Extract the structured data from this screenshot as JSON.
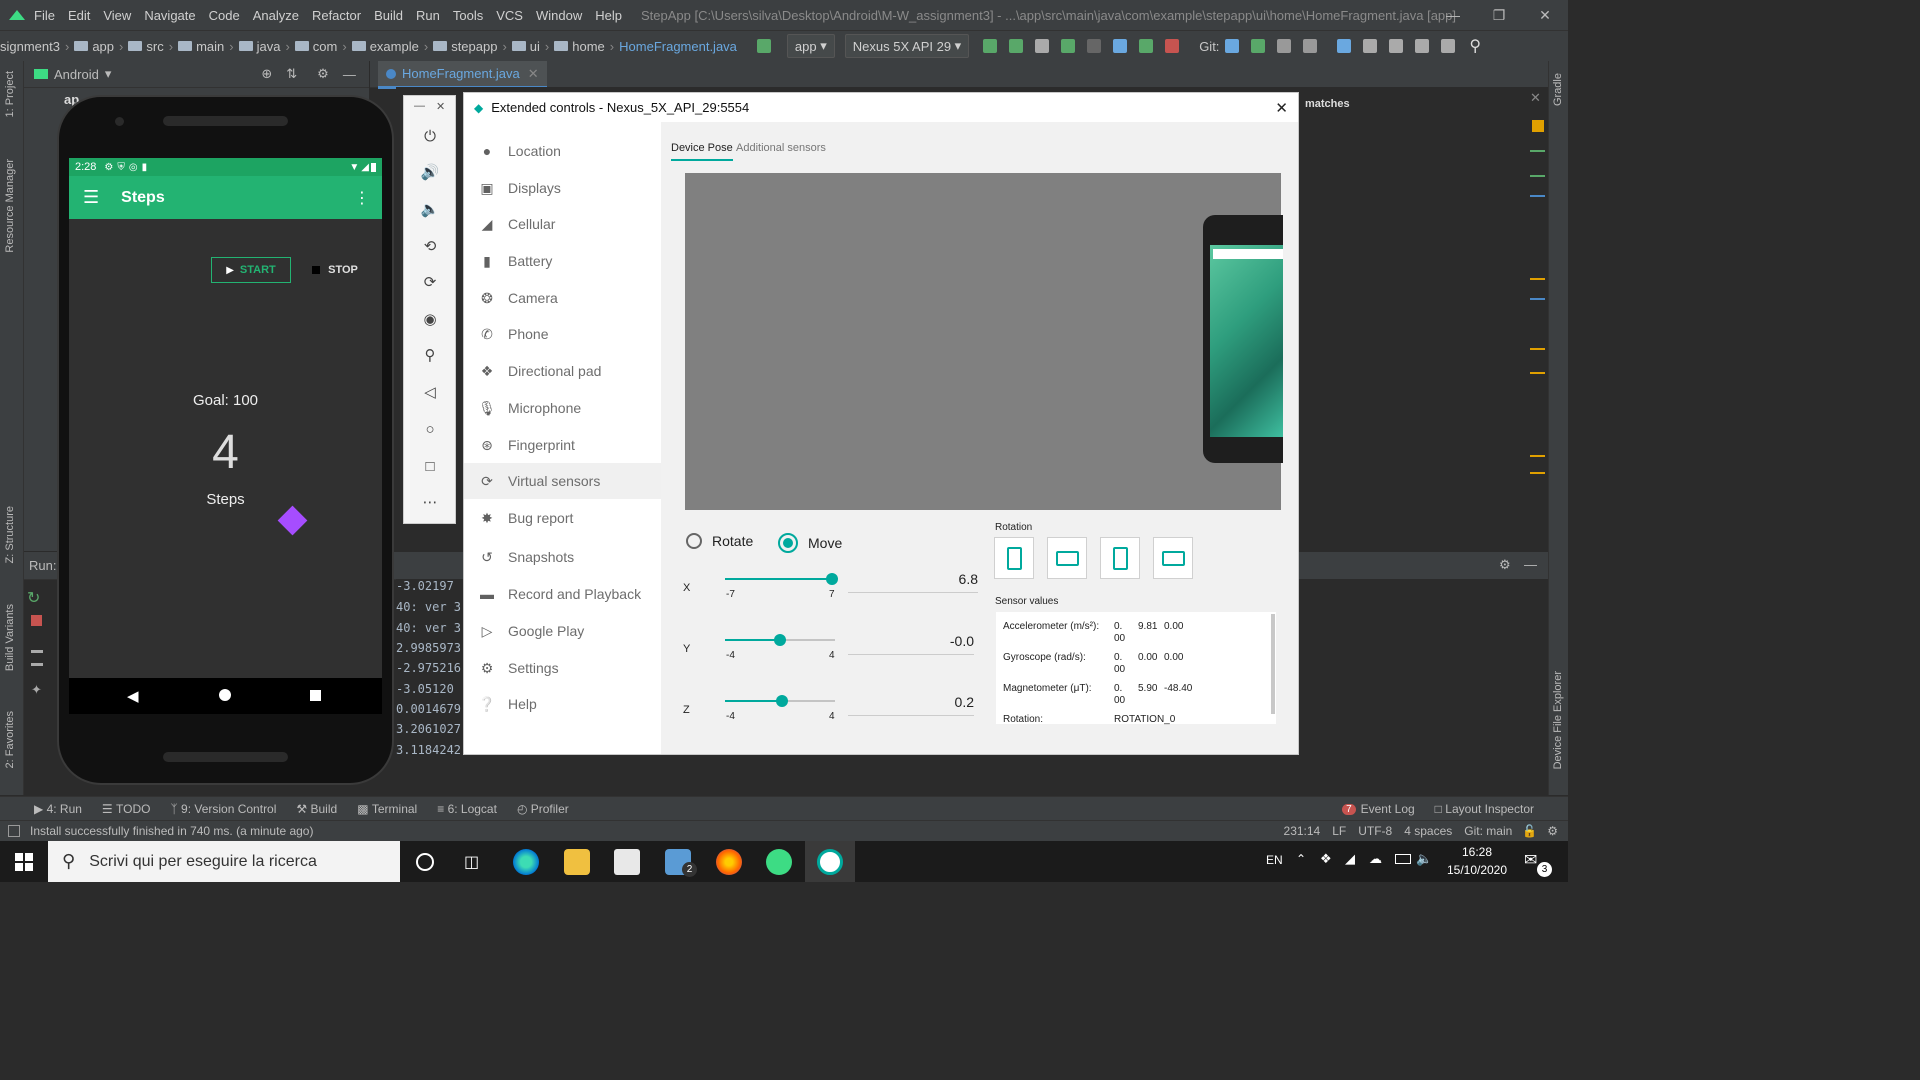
{
  "ide": {
    "menu": [
      "File",
      "Edit",
      "View",
      "Navigate",
      "Code",
      "Analyze",
      "Refactor",
      "Build",
      "Run",
      "Tools",
      "VCS",
      "Window",
      "Help"
    ],
    "window_title": "StepApp [C:\\Users\\silva\\Desktop\\Android\\M-W_assignment3] - ...\\app\\src\\main\\java\\com\\example\\stepapp\\ui\\home\\HomeFragment.java [app]",
    "breadcrumb": [
      "signment3",
      "app",
      "src",
      "main",
      "java",
      "com",
      "example",
      "stepapp",
      "ui",
      "home",
      "HomeFragment.java"
    ],
    "run_config": "app",
    "device_selector": "Nexus 5X API 29",
    "git_label": "Git:",
    "project_view": "Android",
    "editor_tab": "HomeFragment.java",
    "project_tree_stub": "ap",
    "find_matches": "matches",
    "run_label": "Run:",
    "log_lines": [
      "-3.02197",
      "40: ver 3",
      "40: ver 3",
      "2.9985973",
      "-2.975216",
      "-3.05120",
      "0.0014679",
      "3.2061027",
      "3.1184242"
    ],
    "left_strip": [
      "1: Project",
      "Resource Manager",
      "Z: Structure",
      "Build Variants",
      "2: Favorites"
    ],
    "right_strip": [
      "Gradle",
      "Device File Explorer"
    ],
    "tool_tabs": [
      "4: Run",
      "TODO",
      "9: Version Control",
      "Build",
      "Terminal",
      "6: Logcat",
      "Profiler"
    ],
    "event_log_count": "7",
    "event_log": "Event Log",
    "layout_inspector": "Layout Inspector",
    "status_message": "Install successfully finished in 740 ms. (a minute ago)",
    "status_right": [
      "231:14",
      "LF",
      "UTF-8",
      "4 spaces",
      "Git: main"
    ]
  },
  "phone": {
    "time": "2:28",
    "app_title": "Steps",
    "start_label": "START",
    "stop_label": "STOP",
    "goal": "Goal: 100",
    "steps_count": "4",
    "steps_label": "Steps"
  },
  "extended_controls": {
    "title": "Extended controls - Nexus_5X_API_29:5554",
    "sidebar": [
      "Location",
      "Displays",
      "Cellular",
      "Battery",
      "Camera",
      "Phone",
      "Directional pad",
      "Microphone",
      "Fingerprint",
      "Virtual sensors",
      "Bug report",
      "Snapshots",
      "Record and Playback",
      "Google Play",
      "Settings",
      "Help"
    ],
    "selected": "Virtual sensors",
    "tabs": [
      "Device Pose",
      "Additional sensors"
    ],
    "mode_rotate": "Rotate",
    "mode_move": "Move",
    "mode_selected": "Move",
    "sliders": [
      {
        "axis": "X",
        "min": "-7",
        "max": "7",
        "value": "6.8",
        "fraction": 0.97
      },
      {
        "axis": "Y",
        "min": "-4",
        "max": "4",
        "value": "-0.0",
        "fraction": 0.5
      },
      {
        "axis": "Z",
        "min": "-4",
        "max": "4",
        "value": "0.2",
        "fraction": 0.52
      }
    ],
    "rotation_label": "Rotation",
    "sensor_values_label": "Sensor values",
    "sensors": [
      {
        "name": "Accelerometer (m/s²):",
        "v1a": "0.",
        "v1b": "00",
        "v2": "9.81",
        "v3": "0.00"
      },
      {
        "name": "Gyroscope (rad/s):",
        "v1a": "0.",
        "v1b": "00",
        "v2": "0.00",
        "v3": "0.00"
      },
      {
        "name": "Magnetometer (μT):",
        "v1a": "0.",
        "v1b": "00",
        "v2": "5.90",
        "v3": "-48.40"
      }
    ],
    "rotation_row_name": "Rotation:",
    "rotation_row_value": "ROTATION_0"
  },
  "taskbar": {
    "search_placeholder": "Scrivi qui per eseguire la ricerca",
    "mail_badge": "2",
    "language": "EN",
    "time": "16:28",
    "date": "15/10/2020",
    "notif_count": "3"
  },
  "colors": {
    "accent": "#00a99d",
    "app_green": "#23b372",
    "ide_bg": "#2b2b2b",
    "diamond": "#a64dff"
  }
}
